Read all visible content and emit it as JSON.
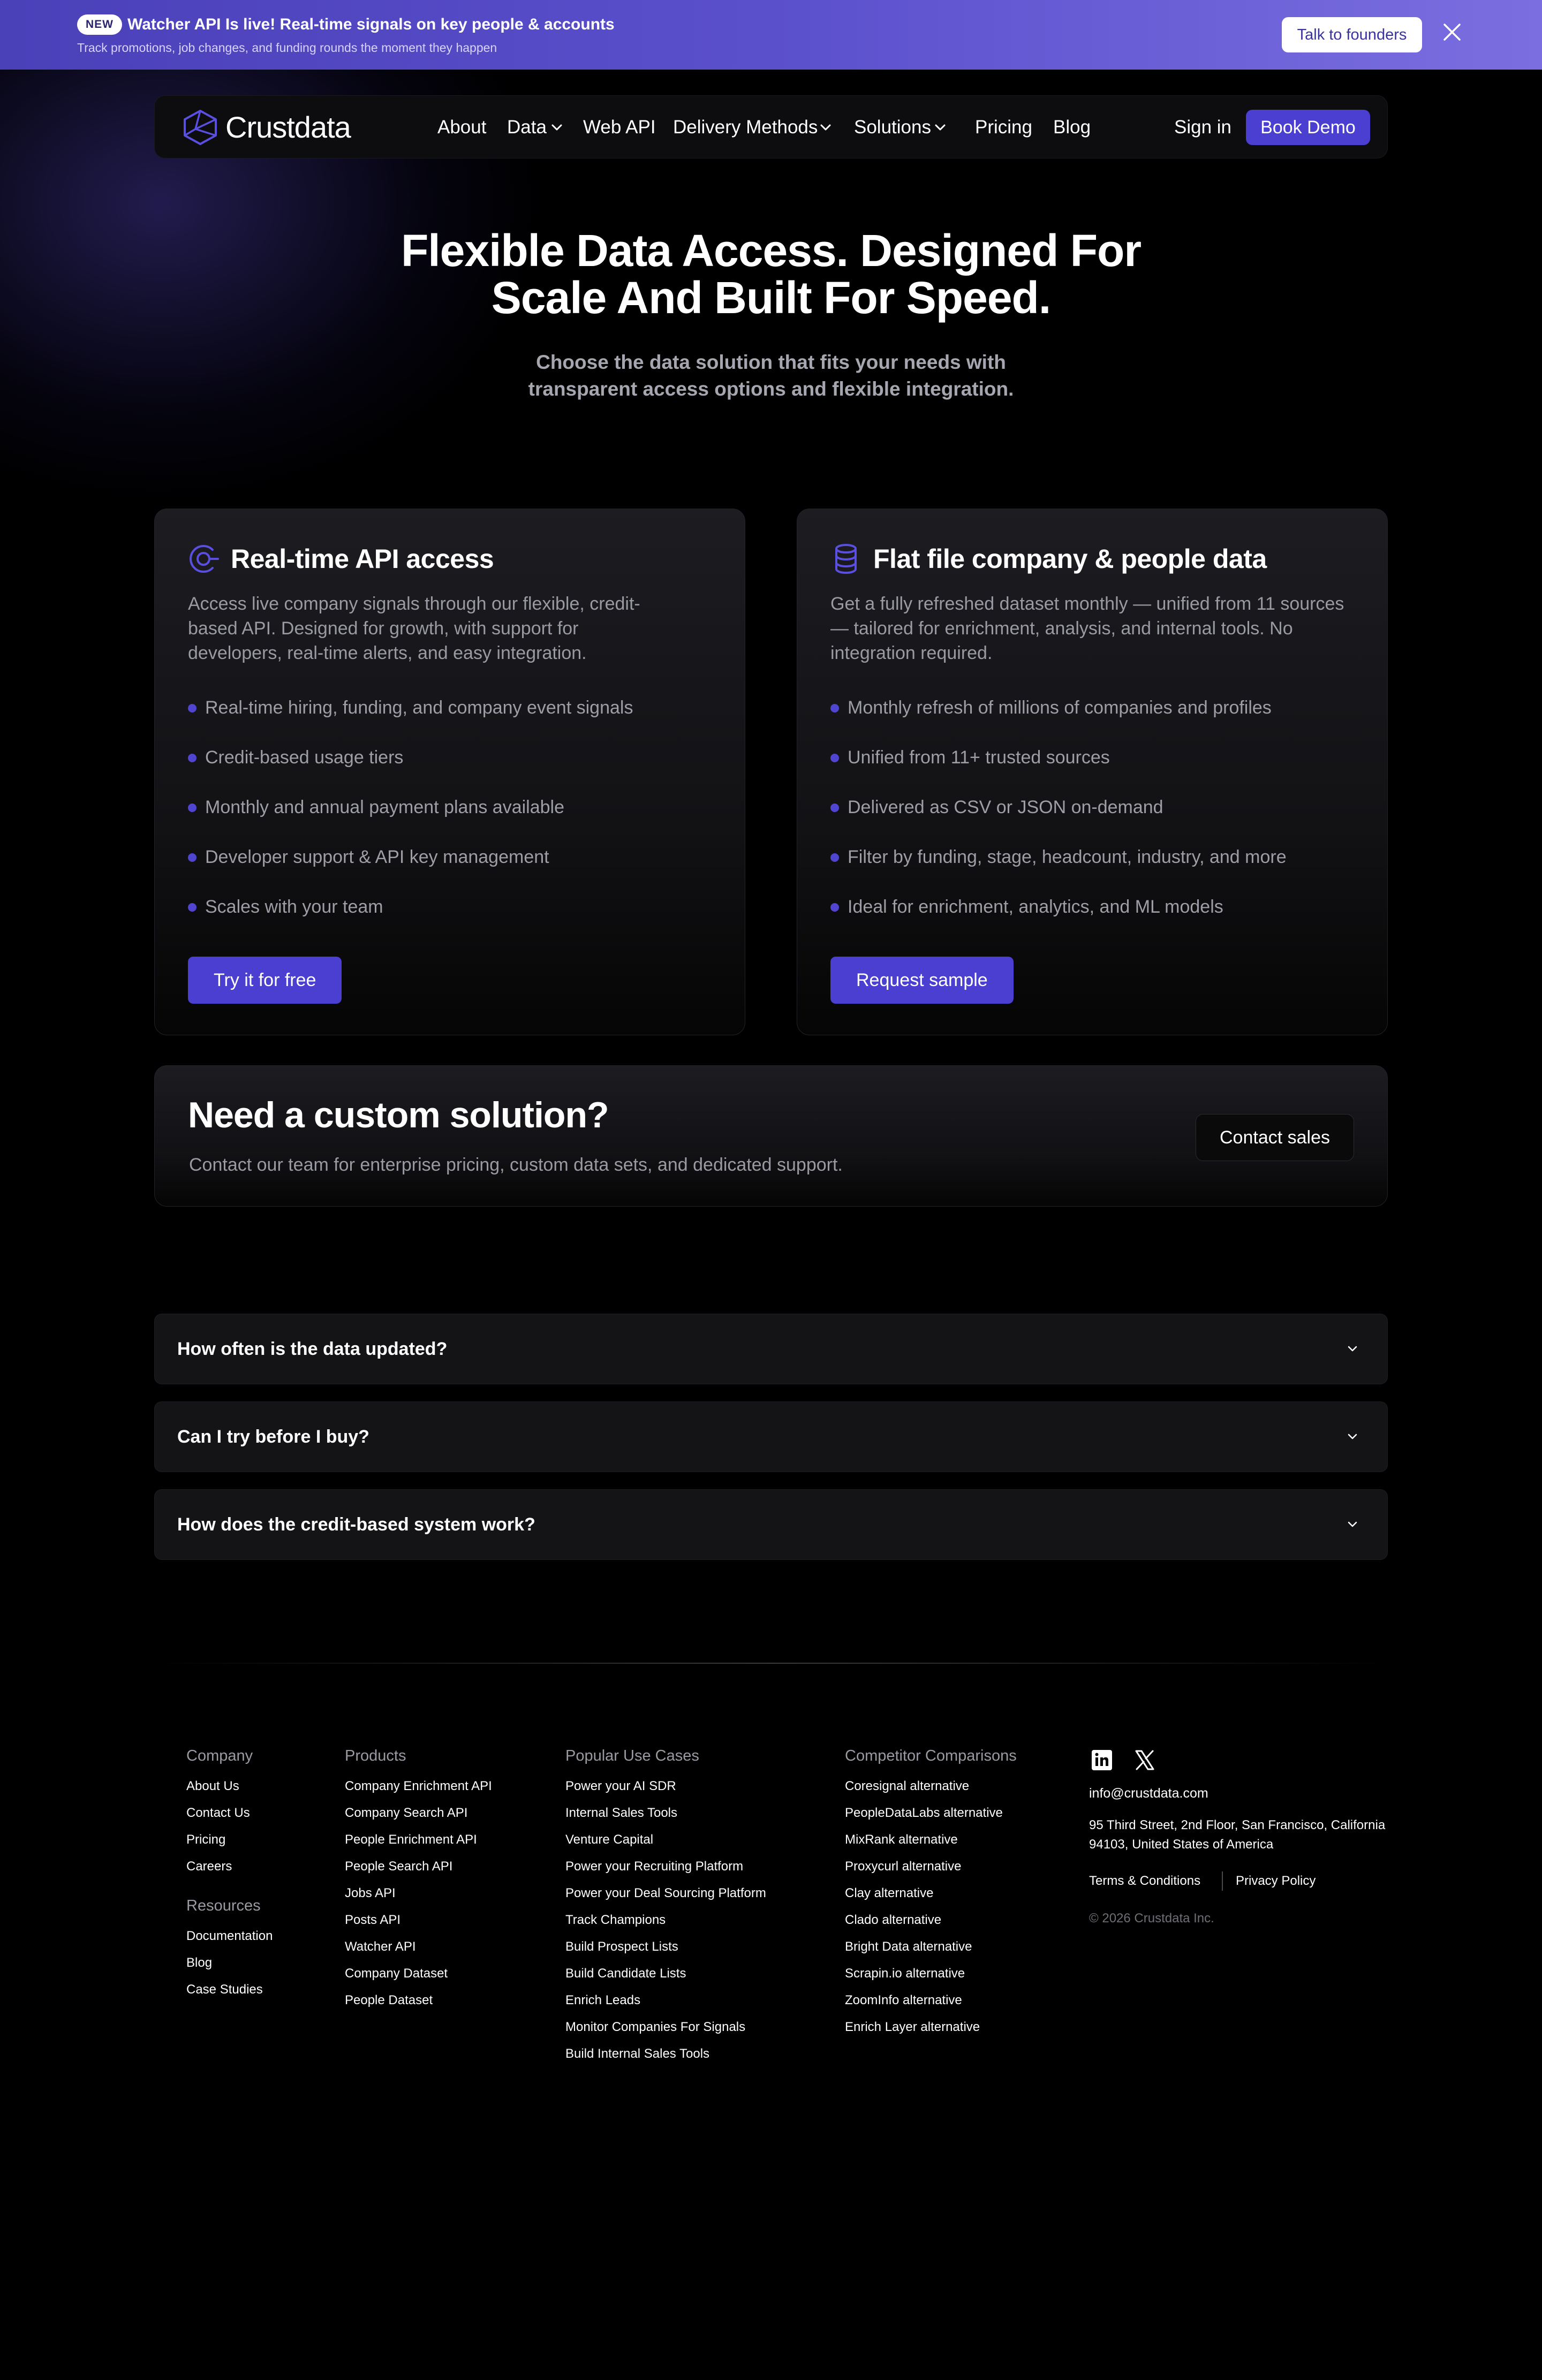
{
  "banner": {
    "badge": "NEW",
    "title": "Watcher API Is live! Real-time signals on key people & accounts",
    "subtitle": "Track promotions, job changes, and funding rounds the moment they happen",
    "cta": "Talk to founders",
    "close_icon": "close-icon"
  },
  "nav": {
    "brand": "Crustdata",
    "items": [
      {
        "label": "About",
        "dropdown": false
      },
      {
        "label": "Data",
        "dropdown": true
      },
      {
        "label": "Web API",
        "dropdown": false
      },
      {
        "label": "Delivery Methods",
        "dropdown": true
      },
      {
        "label": "Solutions",
        "dropdown": true
      },
      {
        "label": "Pricing",
        "dropdown": false
      },
      {
        "label": "Blog",
        "dropdown": false
      }
    ],
    "signin": "Sign in",
    "book_demo": "Book Demo"
  },
  "hero": {
    "title_line1": "Flexible Data Access. Designed For",
    "title_line2": "Scale And Built For Speed.",
    "subtitle_line1": "Choose the data solution that fits your needs with",
    "subtitle_line2": "transparent access options and flexible integration."
  },
  "cards": [
    {
      "icon": "signal-icon",
      "title": "Real-time API access",
      "description": "Access live company signals through our flexible, credit-based API. Designed for growth, with support for developers, real-time alerts, and easy integration.",
      "features": [
        "Real-time hiring, funding, and company event signals",
        "Credit-based usage tiers",
        "Monthly and annual payment plans available",
        "Developer support & API key management",
        "Scales with your team"
      ],
      "cta": "Try it for free"
    },
    {
      "icon": "database-icon",
      "title": "Flat file company & people data",
      "description": "Get a fully refreshed dataset monthly — unified from 11 sources — tailored for enrichment, analysis, and internal tools. No integration required.",
      "features": [
        "Monthly refresh of millions of companies and profiles",
        "Unified from 11+ trusted sources",
        "Delivered as CSV or JSON on-demand",
        "Filter by funding, stage, headcount, industry, and more",
        "Ideal for enrichment, analytics, and ML models"
      ],
      "cta": "Request sample"
    }
  ],
  "custom": {
    "title": "Need a custom solution?",
    "description": "Contact our team for enterprise pricing, custom data sets, and dedicated support.",
    "cta": "Contact sales"
  },
  "faq": [
    "How often is the data updated?",
    "Can I try before I buy?",
    "How does the credit-based system work?"
  ],
  "footer": {
    "company": {
      "heading": "Company",
      "links": [
        "About Us",
        "Contact Us",
        "Pricing",
        "Careers"
      ]
    },
    "resources": {
      "heading": "Resources",
      "links": [
        "Documentation",
        "Blog",
        "Case Studies"
      ]
    },
    "products": {
      "heading": "Products",
      "links": [
        "Company Enrichment API",
        "Company Search API",
        "People Enrichment API",
        "People Search API",
        "Jobs API",
        "Posts API",
        "Watcher API",
        "Company Dataset",
        "People Dataset"
      ]
    },
    "use_cases": {
      "heading": "Popular Use Cases",
      "links": [
        "Power your AI SDR",
        "Internal Sales Tools",
        "Venture Capital",
        "Power your Recruiting Platform",
        "Power your Deal Sourcing Platform",
        "Track Champions",
        "Build Prospect Lists",
        "Build Candidate Lists",
        "Enrich Leads",
        "Monitor Companies For Signals",
        "Build Internal Sales Tools"
      ]
    },
    "competitors": {
      "heading": "Competitor Comparisons",
      "links": [
        "Coresignal alternative",
        "PeopleDataLabs alternative",
        "MixRank alternative",
        "Proxycurl alternative",
        "Clay alternative",
        "Clado alternative",
        "Bright Data alternative",
        "Scrapin.io alternative",
        "ZoomInfo alternative",
        "Enrich Layer alternative"
      ]
    },
    "social_icons": [
      "linkedin-icon",
      "x-icon"
    ],
    "email": "info@crustdata.com",
    "address": "95 Third Street, 2nd Floor, San Francisco, California 94103, United States of America",
    "terms": "Terms & Conditions",
    "privacy": "Privacy Policy",
    "copyright": "© 2026 Crustdata Inc."
  },
  "colors": {
    "accent": "#4a3fd0",
    "banner_start": "#4a40b8",
    "banner_end": "#7a6ee0",
    "background": "#000000"
  }
}
